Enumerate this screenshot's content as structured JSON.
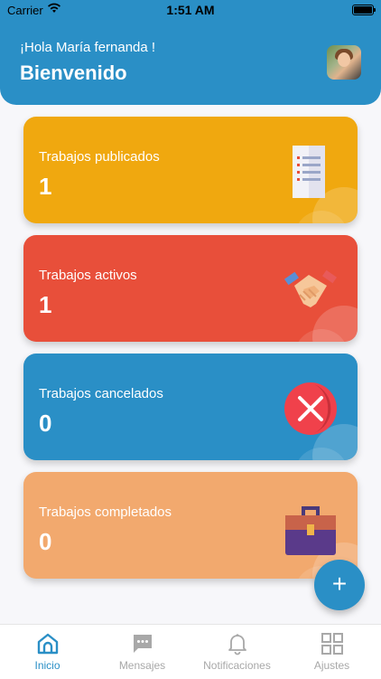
{
  "status_bar": {
    "carrier": "Carrier",
    "time": "1:51 AM"
  },
  "header": {
    "greeting": "¡Hola María fernanda !",
    "welcome": "Bienvenido"
  },
  "cards": [
    {
      "label": "Trabajos publicados",
      "count": "1",
      "color": "#f0a80f",
      "icon": "document-list-icon"
    },
    {
      "label": "Trabajos activos",
      "count": "1",
      "color": "#e84f3a",
      "icon": "handshake-icon"
    },
    {
      "label": "Trabajos cancelados",
      "count": "0",
      "color": "#2a8fc6",
      "icon": "cancel-x-icon"
    },
    {
      "label": "Trabajos completados",
      "count": "0",
      "color": "#f2a96e",
      "icon": "briefcase-icon"
    }
  ],
  "fab": {
    "label": "+"
  },
  "tabs": [
    {
      "label": "Inicio",
      "icon": "home-icon",
      "active": true
    },
    {
      "label": "Mensajes",
      "icon": "chat-icon",
      "active": false
    },
    {
      "label": "Notificaciones",
      "icon": "bell-icon",
      "active": false
    },
    {
      "label": "Ajustes",
      "icon": "grid-icon",
      "active": false
    }
  ],
  "colors": {
    "primary": "#2a8fc6",
    "inactive": "#a8a8a8"
  }
}
